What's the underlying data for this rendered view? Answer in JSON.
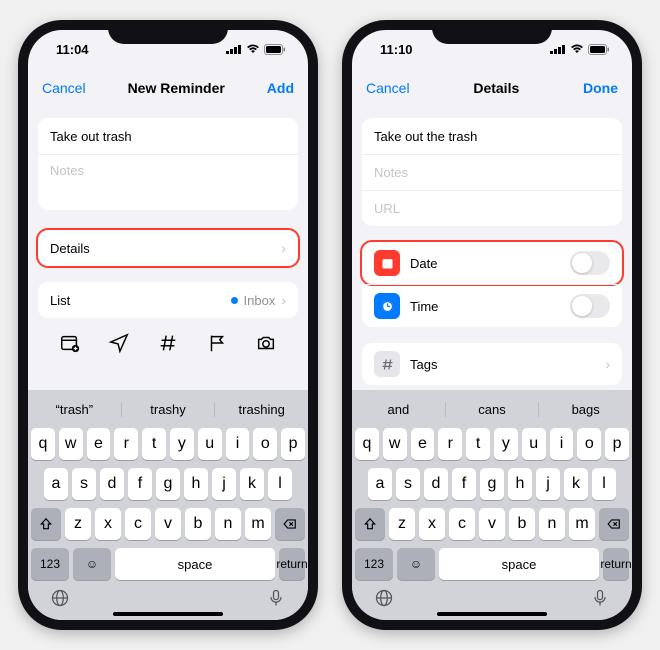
{
  "left": {
    "status": {
      "time": "11:04"
    },
    "nav": {
      "cancel": "Cancel",
      "title": "New Reminder",
      "action": "Add"
    },
    "title_value": "Take out trash",
    "notes_placeholder": "Notes",
    "details_label": "Details",
    "list_label": "List",
    "list_value": "Inbox",
    "suggestions": [
      "“trash”",
      "trashy",
      "trashing"
    ]
  },
  "right": {
    "status": {
      "time": "11:10"
    },
    "nav": {
      "cancel": "Cancel",
      "title": "Details",
      "action": "Done"
    },
    "title_value": "Take out the trash",
    "notes_placeholder": "Notes",
    "url_placeholder": "URL",
    "date_label": "Date",
    "time_label": "Time",
    "tags_label": "Tags",
    "suggestions": [
      "and",
      "cans",
      "bags"
    ]
  },
  "keyboard": {
    "row1": [
      "q",
      "w",
      "e",
      "r",
      "t",
      "y",
      "u",
      "i",
      "o",
      "p"
    ],
    "row2": [
      "a",
      "s",
      "d",
      "f",
      "g",
      "h",
      "j",
      "k",
      "l"
    ],
    "row3": [
      "z",
      "x",
      "c",
      "v",
      "b",
      "n",
      "m"
    ],
    "numKey": "123",
    "space": "space",
    "return": "return"
  }
}
